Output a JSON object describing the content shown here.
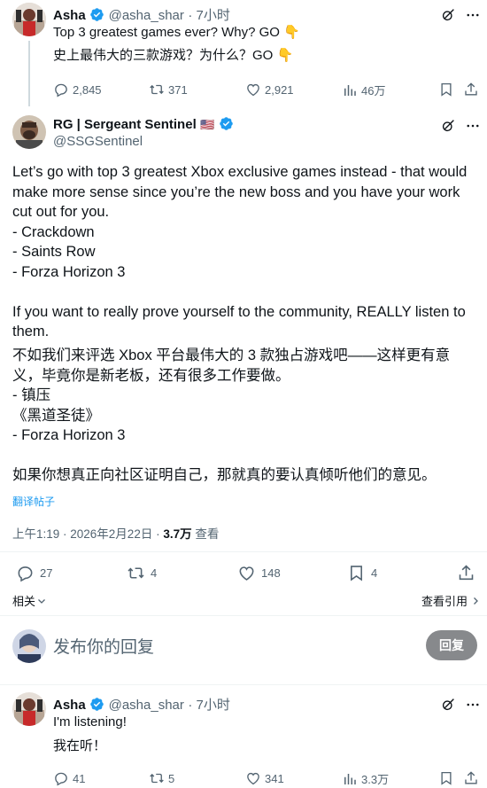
{
  "reply1": {
    "name": "Asha",
    "handle": "@asha_shar",
    "time": "· 7小时",
    "line_en": "Top 3 greatest games ever? Why? GO",
    "line_zh": "史上最伟大的三款游戏？为什么？GO",
    "emoji_hand": "👇",
    "replies": "2,845",
    "reposts": "371",
    "likes": "2,921",
    "views": "46万"
  },
  "main_post": {
    "name": "RG | Sergeant Sentinel",
    "handle": "@SSGSentinel",
    "flag": "🇺🇸",
    "para1": "Let’s go with top 3 greatest Xbox exclusive games instead - that would make more sense since you’re the new boss and you have your work cut out for you.",
    "list_en": [
      "- Crackdown",
      "- Saints Row",
      "- Forza Horizon 3"
    ],
    "para2": "If you want to really prove yourself to the community, REALLY listen to them.",
    "para1_zh": "不如我们来评选 Xbox 平台最伟大的 3 款独占游戏吧——这样更有意义，毕竟你是新老板，还有很多工作要做。",
    "list_zh": [
      "- 镇压",
      "《黑道圣徒》",
      "- Forza Horizon 3"
    ],
    "para2_zh": "如果你想真正向社区证明自己，那就真的要认真倾听他们的意见。",
    "translate_link": "翻译帖子",
    "timestamp": "上午1:19 · 2026年2月22日 · ",
    "views_count": "3.7万",
    "views_label": " 查看",
    "replies": "27",
    "reposts": "4",
    "likes": "148",
    "bookmarks": "4",
    "related": "相关",
    "view_quotes": "查看引用"
  },
  "composer": {
    "placeholder": "发布你的回复",
    "button": "回复"
  },
  "reply2": {
    "name": "Asha",
    "handle": "@asha_shar",
    "time": "· 7小时",
    "line_en": "I'm listening!",
    "line_zh": "我在听！",
    "replies": "41",
    "reposts": "5",
    "likes": "341",
    "views": "3.3万"
  },
  "colors": {
    "text": "#0f1419",
    "muted": "#536471",
    "accent": "#1d9bf0",
    "reply_button": "#87898c"
  }
}
